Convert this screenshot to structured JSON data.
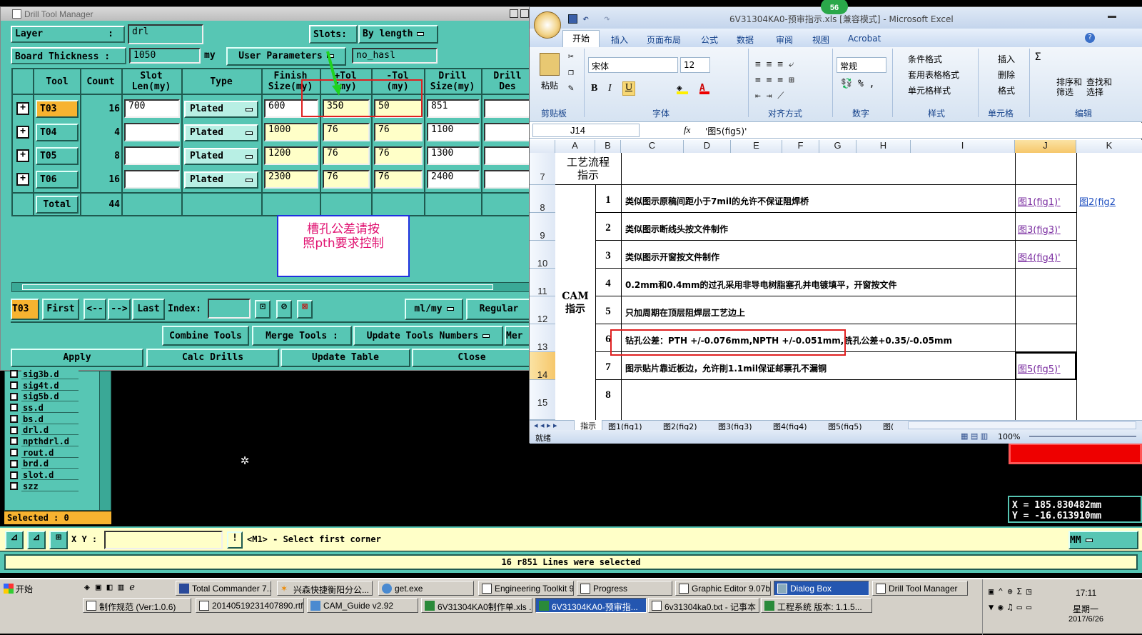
{
  "dtm": {
    "title": "Drill Tool Manager",
    "layer_label": "Layer",
    "layer_colon": ":",
    "layer_value": "drl",
    "slots_label": "Slots:",
    "slots_value": "By length",
    "board_label": "Board Thickness :",
    "board_value": "1050",
    "board_unit": "my",
    "user_params_label": "User Parameters",
    "user_params_value": "no_hasl",
    "headers": {
      "tool": "Tool",
      "count": "Count",
      "slot": "Slot\nLen(my)",
      "type": "Type",
      "finish": "Finish\nSize(my)",
      "ptol": "+Tol\n(my)",
      "ntol": "-Tol\n(my)",
      "drill": "Drill\nSize(my)",
      "drilldes": "Drill\nDes"
    },
    "rows": [
      {
        "tool": "T03",
        "count": "16",
        "slot": "700",
        "type": "Plated",
        "finish": "600",
        "ptol": "350",
        "ntol": "50",
        "drill": "851"
      },
      {
        "tool": "T04",
        "count": "4",
        "slot": "",
        "type": "Plated",
        "finish": "1000",
        "ptol": "76",
        "ntol": "76",
        "drill": "1100"
      },
      {
        "tool": "T05",
        "count": "8",
        "slot": "",
        "type": "Plated",
        "finish": "1200",
        "ptol": "76",
        "ntol": "76",
        "drill": "1300"
      },
      {
        "tool": "T06",
        "count": "16",
        "slot": "",
        "type": "Plated",
        "finish": "2300",
        "ptol": "76",
        "ntol": "76",
        "drill": "2400"
      }
    ],
    "total_label": "Total",
    "total_value": "44",
    "note_line1": "槽孔公差请按",
    "note_line2": "照pth要求控制",
    "current_tool": "T03",
    "nav": {
      "first": "First",
      "prev": "<--",
      "next": "-->",
      "last": "Last",
      "index": "Index:",
      "unit": "ml/my",
      "regular": "Regular"
    },
    "actions": {
      "combine": "Combine Tools",
      "merge": "Merge Tools :",
      "update_nums": "Update Tools Numbers",
      "more": "Mer",
      "apply": "Apply",
      "calc": "Calc Drills",
      "update_table": "Update Table",
      "close": "Close"
    }
  },
  "layers": [
    "sig3b.d",
    "sig4t.d",
    "sig5b.d",
    "ss.d",
    "bs.d",
    "drl.d",
    "npthdrl.d",
    "rout.d",
    "brd.d",
    "slot.d",
    "szz"
  ],
  "selected": "Selected : 0",
  "coords": {
    "x": "X  =  185.830482mm",
    "y": "Y  = -16.613910mm"
  },
  "status": {
    "xy_label": "X Y :",
    "prompt": "<M1> - Select first corner",
    "unit": "MM",
    "message": "16 r851 Lines were selected"
  },
  "excel": {
    "title": "6V31304KA0-预审指示.xls  [兼容模式] - Microsoft Excel",
    "badge": "56",
    "tabs": [
      "开始",
      "插入",
      "页面布局",
      "公式",
      "数据",
      "审阅",
      "视图",
      "Acrobat"
    ],
    "groups": [
      "剪贴板",
      "字体",
      "对齐方式",
      "数字",
      "样式",
      "单元格",
      "编辑"
    ],
    "paste": "粘贴",
    "font_name": "宋体",
    "font_size": "12",
    "number_format": "常规",
    "styles": [
      "条件格式",
      "套用表格格式",
      "单元格样式"
    ],
    "cells_btns": [
      "插入",
      "删除",
      "格式"
    ],
    "edit_btns": [
      "排序和\n筛选",
      "查找和\n选择"
    ],
    "namebox": "J14",
    "formula": "'图5(fig5)'",
    "cols": [
      "A",
      "B",
      "C",
      "D",
      "E",
      "F",
      "G",
      "H",
      "I",
      "J",
      "K"
    ],
    "row_nums": [
      "7",
      "8",
      "9",
      "10",
      "11",
      "12",
      "13",
      "14",
      "15"
    ],
    "header_cell": "工艺流程\n指示",
    "cam_label": "CAM\n指示",
    "items": [
      {
        "n": "1",
        "text": "类似图示原稿间距小于7mil的允许不保证阻焊桥",
        "link": "图1(fig1)'",
        "link2": "图2(fig2"
      },
      {
        "n": "2",
        "text": "类似图示断线头按文件制作",
        "link": "图3(fig3)'"
      },
      {
        "n": "3",
        "text": "类似图示开窗按文件制作",
        "link": "图4(fig4)'"
      },
      {
        "n": "4",
        "text": "0.2mm和0.4mm的过孔采用非导电树脂塞孔并电镀填平，开窗按文件",
        "link": ""
      },
      {
        "n": "5",
        "text": "只加周期在顶层阻焊层工艺边上",
        "link": ""
      },
      {
        "n": "6",
        "text": "钻孔公差：PTH +/-0.076mm,NPTH +/-0.051mm,铣孔公差+0.35/-0.05mm",
        "link": ""
      },
      {
        "n": "7",
        "text": "图示贴片靠近板边，允许削1.1mil保证邮票孔不漏铜",
        "link": "图5(fig5)'"
      },
      {
        "n": "8",
        "text": "",
        "link": ""
      }
    ],
    "sheets": [
      "指示",
      "图1(fig1)",
      "图2(fig2)",
      "图3(fig3)",
      "图4(fig4)",
      "图5(fig5)",
      "图("
    ],
    "status_ready": "就绪",
    "zoom": "100%"
  },
  "taskbar": {
    "start": "开始",
    "row1": [
      "Total Commander 7....",
      "兴森快捷衡阳分公...",
      "get.exe",
      "Engineering Toolkit 9...",
      "Progress",
      "Graphic Editor 9.07b...",
      "Dialog Box",
      "Drill Tool Manager"
    ],
    "row2": [
      "制作规范 (Ver:1.0.6)",
      "20140519231407890.rtf...",
      "CAM_Guide v2.92",
      "6V31304KA0制作单.xls ...",
      "6V31304KA0-预审指...",
      "6v31304ka0.txt - 记事本",
      "工程系统  版本: 1.1.5..."
    ],
    "time": "17:11",
    "day": "星期一",
    "date": "2017/6/26"
  }
}
